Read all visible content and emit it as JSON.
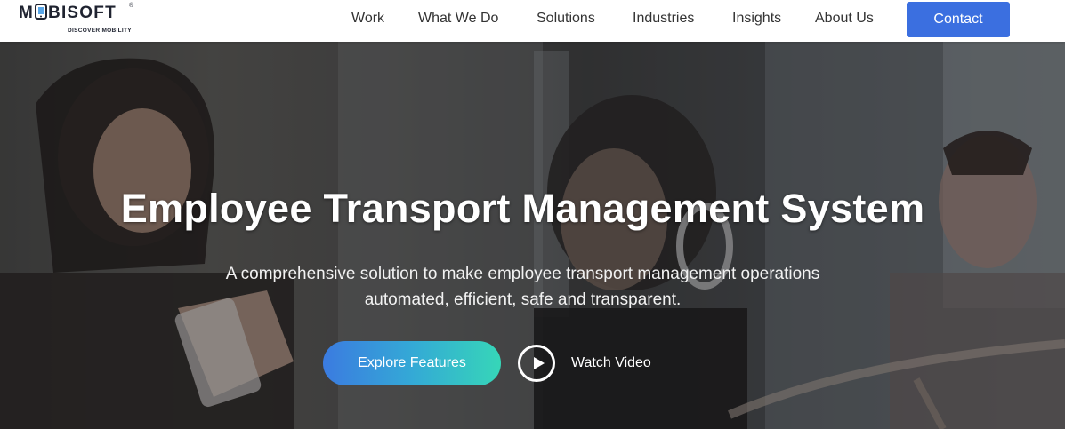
{
  "brand": {
    "name_pre": "M",
    "name_post": "BISOFT",
    "registered": "®",
    "tagline": "DISCOVER MOBILITY",
    "accent_color": "#3b6fe0"
  },
  "nav": {
    "items": [
      {
        "label": "Work"
      },
      {
        "label": "What We Do"
      },
      {
        "label": "Solutions"
      },
      {
        "label": "Industries"
      },
      {
        "label": "Insights"
      },
      {
        "label": "About Us"
      }
    ],
    "contact_label": "Contact"
  },
  "hero": {
    "title": "Employee Transport Management System",
    "subtitle": "A comprehensive solution to make employee transport management operations automated, efficient, safe and transparent.",
    "primary_cta": "Explore Features",
    "secondary_cta": "Watch Video",
    "secondary_icon": "play-icon",
    "cta_gradient": [
      "#3b7be0",
      "#34a9d6",
      "#36d6b8"
    ]
  }
}
